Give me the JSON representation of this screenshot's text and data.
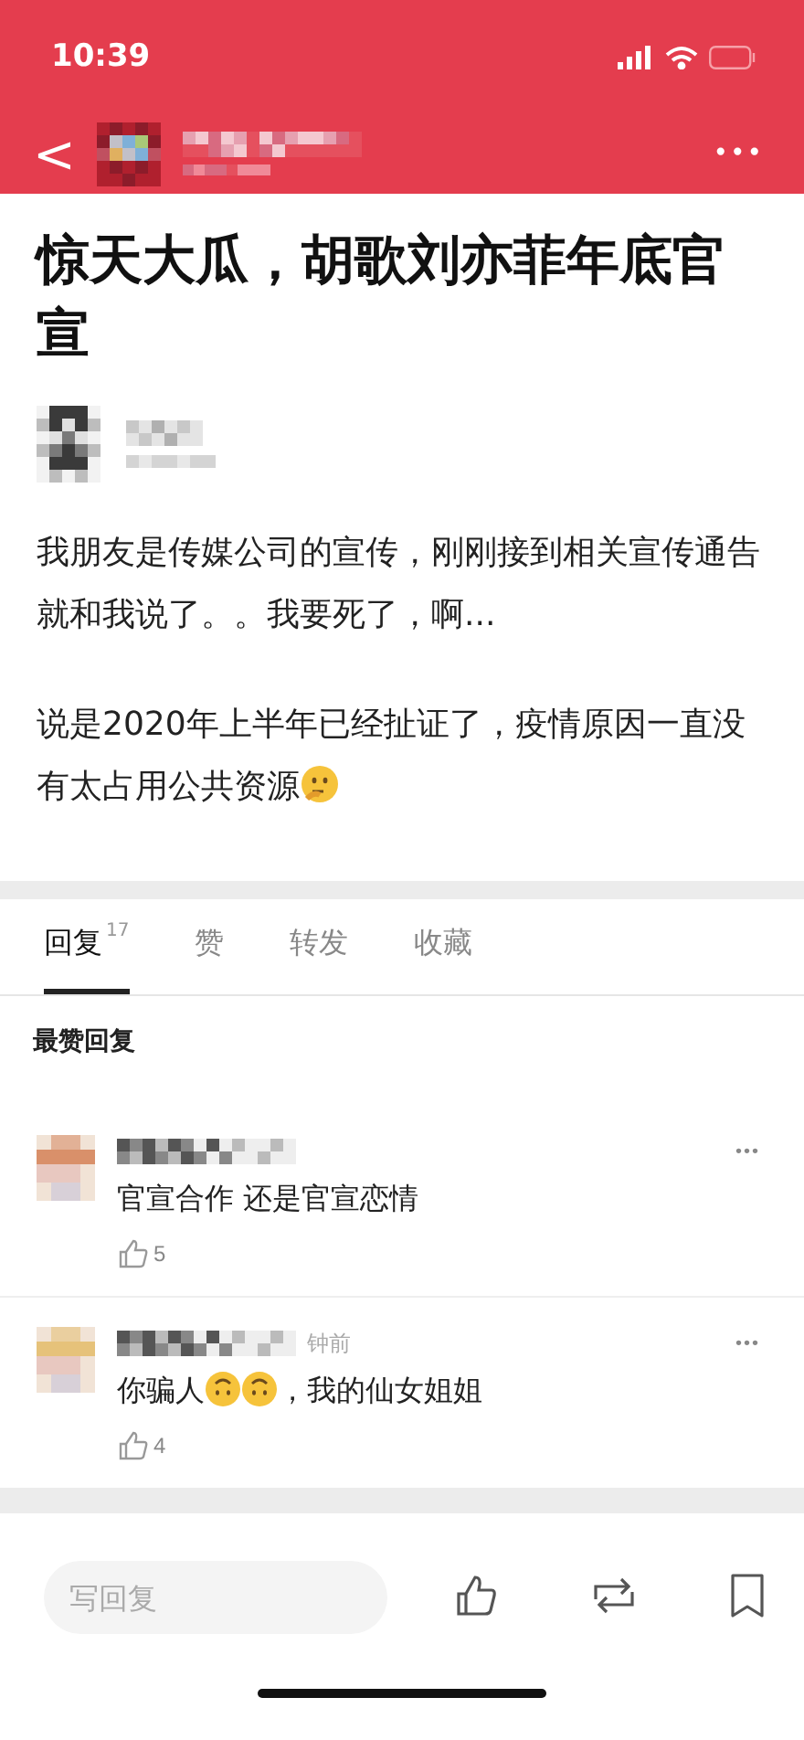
{
  "status_bar": {
    "time": "10:39"
  },
  "nav": {
    "back": "<",
    "more": "•••"
  },
  "post": {
    "title": "惊天大瓜，胡歌刘亦菲年底官宣",
    "paragraphs": [
      {
        "parts": [
          {
            "kind": "text",
            "text": "我朋友是传媒公司的宣传，刚刚接到相关宣传通告就和我说了。。我要死了，啊..."
          }
        ]
      },
      {
        "parts": [
          {
            "kind": "text",
            "text": "说是2020年上半年已经扯证了，疫情原因一直没有太占用公共资源"
          },
          {
            "kind": "emoji"
          }
        ]
      }
    ]
  },
  "tabs": [
    {
      "label": "回复",
      "count": "17",
      "selected": true
    },
    {
      "label": "赞",
      "selected": false
    },
    {
      "label": "转发",
      "selected": false
    },
    {
      "label": "收藏",
      "selected": false
    }
  ],
  "section_title": "最赞回复",
  "comments": [
    {
      "parts": [
        {
          "kind": "text",
          "text": "官宣合作 还是官宣恋情"
        }
      ],
      "likes": "5"
    },
    {
      "time": "钟前",
      "parts": [
        {
          "kind": "text",
          "text": "你骗人"
        },
        {
          "kind": "emoji"
        },
        {
          "kind": "emoji"
        },
        {
          "kind": "text",
          "text": "，我的仙女姐姐"
        }
      ],
      "likes": "4"
    }
  ],
  "bottom_bar": {
    "placeholder": "写回复"
  }
}
